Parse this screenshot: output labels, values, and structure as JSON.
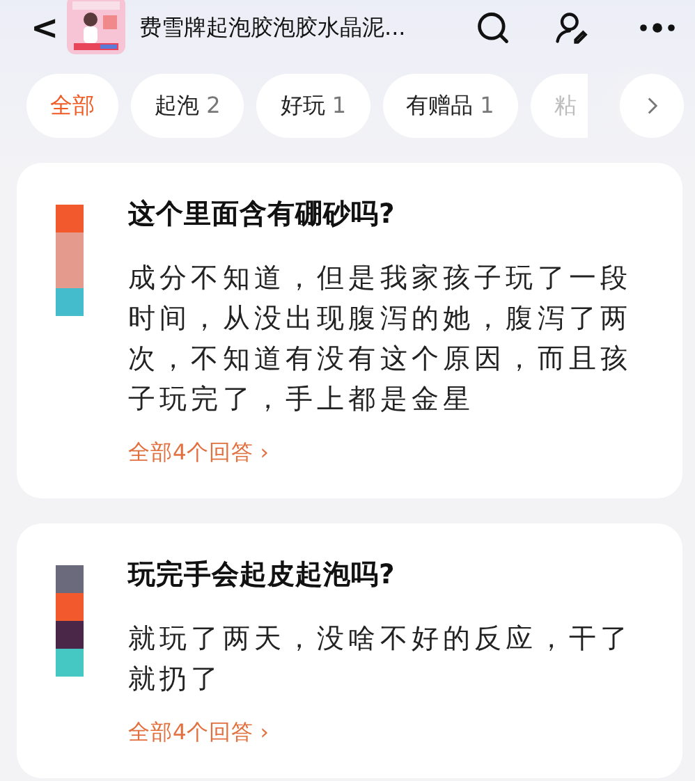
{
  "header": {
    "back": "<",
    "title": "费雪牌起泡胶泡胶水晶泥..."
  },
  "filters": [
    {
      "label": "全部",
      "selected": true
    },
    {
      "label": "起泡",
      "count": "2",
      "selected": false
    },
    {
      "label": "好玩",
      "count": "1",
      "selected": false
    },
    {
      "label": "有赠品",
      "count": "1",
      "selected": false
    },
    {
      "label": "粘",
      "selected": false
    }
  ],
  "questions": [
    {
      "question": "这个里面含有硼砂吗?",
      "answer": "成分不知道，但是我家孩子玩了一段时间，从没出现腹泻的她，腹泻了两次，不知道有没有这个原因，而且孩子玩完了，手上都是金星",
      "link": "全部4个回答 ›"
    },
    {
      "question": "玩完手会起皮起泡吗?",
      "answer": "就玩了两天，没啥不好的反应，干了就扔了",
      "link": "全部4个回答 ›"
    }
  ]
}
